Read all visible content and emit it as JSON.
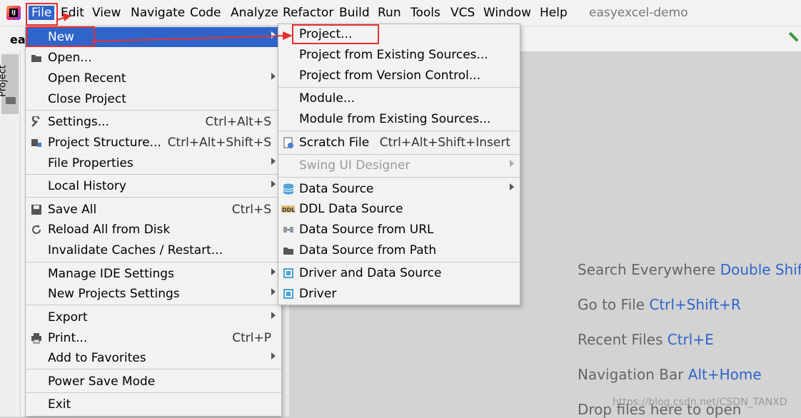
{
  "menubar": {
    "items": [
      "File",
      "Edit",
      "View",
      "Navigate",
      "Code",
      "Analyze",
      "Refactor",
      "Build",
      "Run",
      "Tools",
      "VCS",
      "Window",
      "Help"
    ],
    "project_title": "easyexcel-demo"
  },
  "breadcrumb": "eas",
  "toolwindow": {
    "project_tab": "Project"
  },
  "file_menu": {
    "new": "New",
    "open": "Open...",
    "open_recent": "Open Recent",
    "close_project": "Close Project",
    "settings": "Settings...",
    "settings_sc": "Ctrl+Alt+S",
    "project_structure": "Project Structure...",
    "project_structure_sc": "Ctrl+Alt+Shift+S",
    "file_properties": "File Properties",
    "local_history": "Local History",
    "save_all": "Save All",
    "save_all_sc": "Ctrl+S",
    "reload": "Reload All from Disk",
    "invalidate": "Invalidate Caches / Restart...",
    "manage_ide": "Manage IDE Settings",
    "new_projects_settings": "New Projects Settings",
    "export": "Export",
    "print": "Print...",
    "print_sc": "Ctrl+P",
    "add_favorites": "Add to Favorites",
    "power_save": "Power Save Mode",
    "exit": "Exit"
  },
  "new_menu": {
    "project": "Project...",
    "from_existing": "Project from Existing Sources...",
    "from_vcs": "Project from Version Control...",
    "module": "Module...",
    "module_existing": "Module from Existing Sources...",
    "scratch": "Scratch File",
    "scratch_sc": "Ctrl+Alt+Shift+Insert",
    "swing": "Swing UI Designer",
    "data_source": "Data Source",
    "ddl_data_source": "DDL Data Source",
    "ds_url": "Data Source from URL",
    "ds_path": "Data Source from Path",
    "driver_ds": "Driver and Data Source",
    "driver": "Driver"
  },
  "welcome": {
    "search_text": "Search Everywhere",
    "search_key": "Double Shift",
    "goto_text": "Go to File",
    "goto_key": "Ctrl+Shift+R",
    "recent_text": "Recent Files",
    "recent_key": "Ctrl+E",
    "nav_text": "Navigation Bar",
    "nav_key": "Alt+Home",
    "drop_text": "Drop files here to open"
  },
  "watermark": "https://blog.csdn.net/CSDN_TANXD",
  "icons": {
    "app": "intellij-logo-icon",
    "build": "hammer-icon"
  },
  "colors": {
    "accent": "#2f65ca",
    "annotation": "#e53030"
  }
}
